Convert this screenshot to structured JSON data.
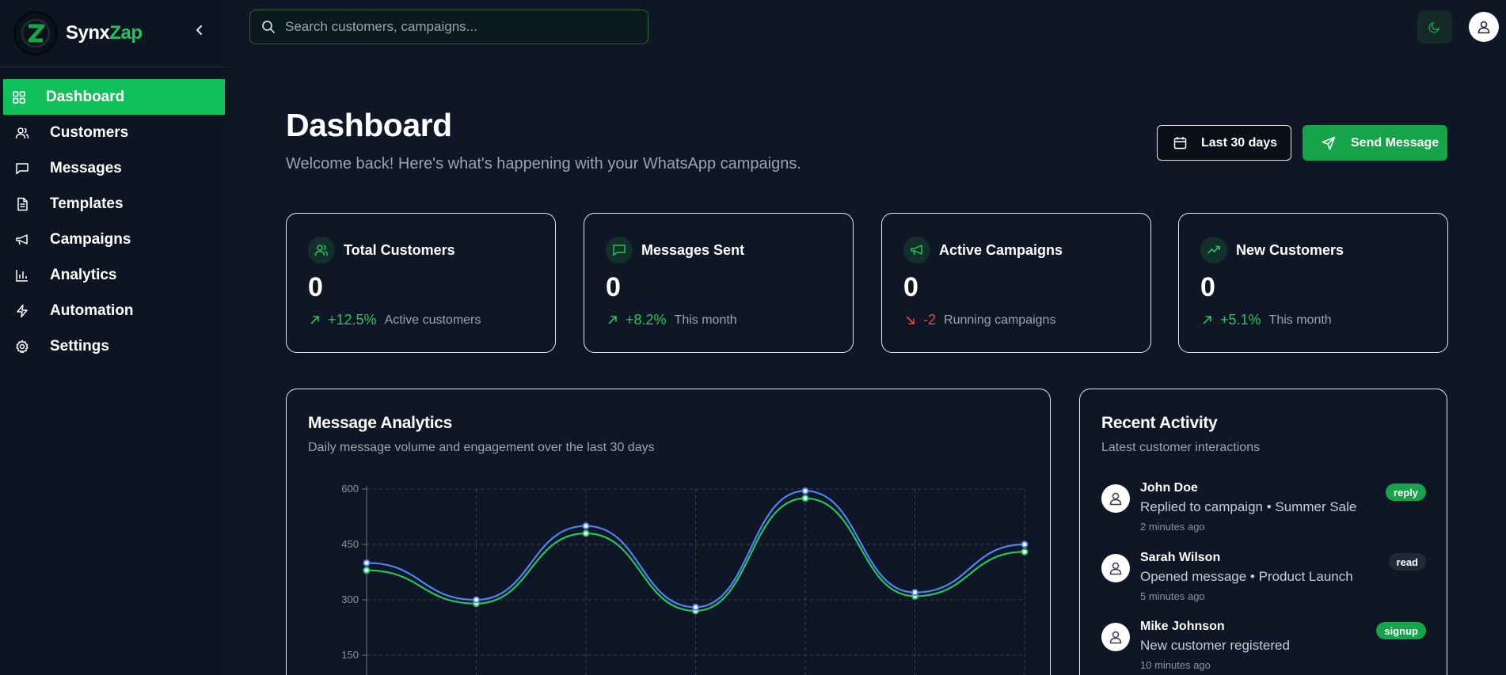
{
  "brand": {
    "name_part1": "Synx",
    "name_part2": "Zap"
  },
  "sidebar": {
    "items": [
      {
        "label": "Dashboard",
        "icon": "grid-icon",
        "active": true
      },
      {
        "label": "Customers",
        "icon": "users-icon"
      },
      {
        "label": "Messages",
        "icon": "message-icon"
      },
      {
        "label": "Templates",
        "icon": "file-text-icon"
      },
      {
        "label": "Campaigns",
        "icon": "megaphone-icon"
      },
      {
        "label": "Analytics",
        "icon": "bar-chart-icon"
      },
      {
        "label": "Automation",
        "icon": "zap-icon"
      },
      {
        "label": "Settings",
        "icon": "gear-icon"
      }
    ]
  },
  "search": {
    "placeholder": "Search customers, campaigns..."
  },
  "header": {
    "title": "Dashboard",
    "subtitle": "Welcome back! Here's what's happening with your WhatsApp campaigns.",
    "range_label": "Last 30 days",
    "send_label": "Send Message"
  },
  "stats": [
    {
      "label": "Total Customers",
      "value": "0",
      "delta": "+12.5%",
      "trend": "up",
      "note": "Active customers",
      "icon": "users-icon"
    },
    {
      "label": "Messages Sent",
      "value": "0",
      "delta": "+8.2%",
      "trend": "up",
      "note": "This month",
      "icon": "message-icon"
    },
    {
      "label": "Active Campaigns",
      "value": "0",
      "delta": "-2",
      "trend": "down",
      "note": "Running campaigns",
      "icon": "megaphone-icon"
    },
    {
      "label": "New Customers",
      "value": "0",
      "delta": "+5.1%",
      "trend": "up",
      "note": "This month",
      "icon": "trending-up-icon"
    }
  ],
  "analytics": {
    "title": "Message Analytics",
    "description": "Daily message volume and engagement over the last 30 days"
  },
  "chart_data": {
    "type": "line",
    "x": [
      0,
      1,
      2,
      3,
      4,
      5,
      6
    ],
    "series": [
      {
        "values": [
          400,
          300,
          500,
          280,
          595,
          320,
          450
        ],
        "color": "#4f83f7"
      },
      {
        "values": [
          380,
          290,
          480,
          270,
          575,
          310,
          430
        ],
        "color": "#22c55e"
      }
    ],
    "ylim": [
      150,
      600
    ],
    "yticks": [
      "600",
      "450",
      "300",
      "150"
    ],
    "grid": true
  },
  "activity": {
    "title": "Recent Activity",
    "description": "Latest customer interactions",
    "items": [
      {
        "name": "John Doe",
        "text": "Replied to campaign • Summer Sale",
        "time": "2 minutes ago",
        "tag": "reply",
        "tag_style": "green"
      },
      {
        "name": "Sarah Wilson",
        "text": "Opened message • Product Launch",
        "time": "5 minutes ago",
        "tag": "read",
        "tag_style": "dark"
      },
      {
        "name": "Mike Johnson",
        "text": "New customer registered",
        "time": "10 minutes ago",
        "tag": "signup",
        "tag_style": "green"
      }
    ]
  },
  "colors": {
    "accent": "#10c05a",
    "background": "#0f1625",
    "negative": "#ef4444"
  }
}
